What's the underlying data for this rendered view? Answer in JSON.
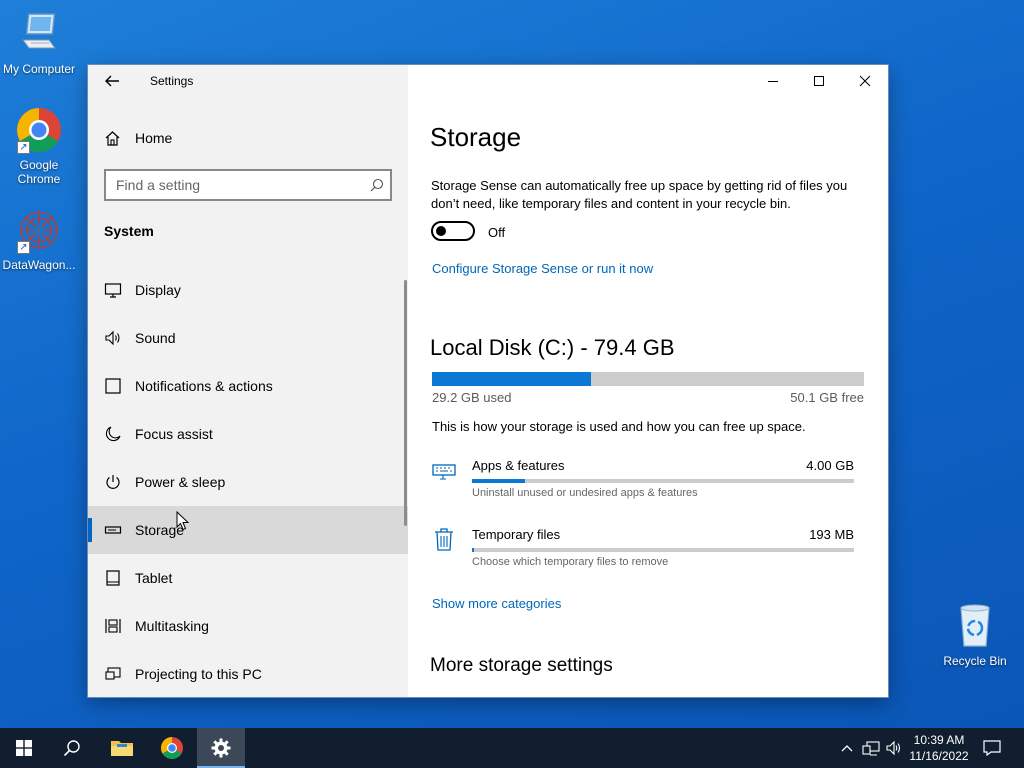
{
  "desktop": {
    "icons": [
      {
        "label": "My Computer",
        "icon": "computer-icon"
      },
      {
        "label": "Google Chrome",
        "icon": "chrome-icon"
      },
      {
        "label": "DataWagon...",
        "icon": "datawagon-icon"
      },
      {
        "label": "Recycle Bin",
        "icon": "recycle-bin-icon"
      }
    ]
  },
  "window": {
    "title": "Settings",
    "controls": {
      "minimize": "minimize-icon",
      "maximize": "maximize-icon",
      "close": "close-icon"
    }
  },
  "sidebar": {
    "home_label": "Home",
    "search_placeholder": "Find a setting",
    "section_label": "System",
    "items": [
      {
        "label": "Display",
        "icon": "display-icon"
      },
      {
        "label": "Sound",
        "icon": "sound-icon"
      },
      {
        "label": "Notifications & actions",
        "icon": "notifications-icon"
      },
      {
        "label": "Focus assist",
        "icon": "moon-icon"
      },
      {
        "label": "Power & sleep",
        "icon": "power-icon"
      },
      {
        "label": "Storage",
        "icon": "storage-icon",
        "active": true
      },
      {
        "label": "Tablet",
        "icon": "tablet-icon"
      },
      {
        "label": "Multitasking",
        "icon": "multitasking-icon"
      },
      {
        "label": "Projecting to this PC",
        "icon": "projecting-icon"
      }
    ]
  },
  "content": {
    "title": "Storage",
    "storage_sense_desc": "Storage Sense can automatically free up space by getting rid of files you don’t need, like temporary files and content in your recycle bin.",
    "toggle_state": "Off",
    "configure_link": "Configure Storage Sense or run it now",
    "disk_title": "Local Disk (C:) - 79.4 GB",
    "disk_used_fraction": 0.368,
    "disk_used": "29.2 GB used",
    "disk_free": "50.1 GB free",
    "usage_desc": "This is how your storage is used and how you can free up space.",
    "categories": [
      {
        "name": "Apps & features",
        "size": "4.00 GB",
        "sub": "Uninstall unused or undesired apps & features",
        "fraction": 0.14,
        "icon": "apps-features-icon"
      },
      {
        "name": "Temporary files",
        "size": "193 MB",
        "sub": "Choose which temporary files to remove",
        "fraction": 0.006,
        "icon": "trash-icon"
      }
    ],
    "show_more_link": "Show more categories",
    "more_settings_title": "More storage settings"
  },
  "taskbar": {
    "time": "10:39 AM",
    "date": "11/16/2022"
  },
  "colors": {
    "accent": "#0067c0",
    "bar_fill": "#0a78d4",
    "taskbar": "#101e30"
  }
}
